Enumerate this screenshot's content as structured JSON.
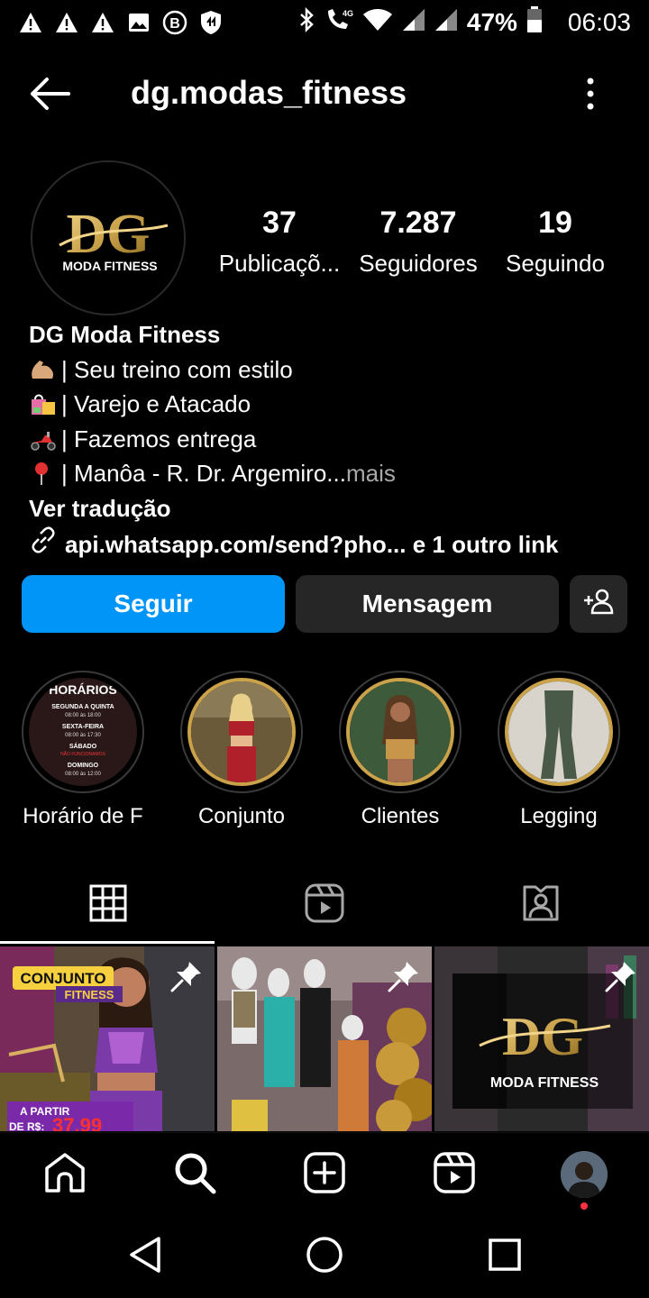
{
  "status_bar": {
    "battery": "47%",
    "time": "06:03",
    "icons_left": [
      "warning-icon",
      "warning-icon",
      "warning-icon",
      "image-icon",
      "b-icon",
      "shield-icon"
    ],
    "icons_right": [
      "bluetooth-icon",
      "phone-4g-icon",
      "wifi-icon",
      "signal-icon",
      "signal-icon",
      "battery-icon"
    ]
  },
  "header": {
    "username": "dg.modas_fitness"
  },
  "profile": {
    "avatar_text_top": "DG",
    "avatar_text_bottom": "MODA FITNESS",
    "stats": [
      {
        "value": "37",
        "label": "Publicaçõ..."
      },
      {
        "value": "7.287",
        "label": "Seguidores"
      },
      {
        "value": "19",
        "label": "Seguindo"
      }
    ],
    "name": "DG Moda Fitness",
    "bio_lines": [
      "| Seu treino com estilo",
      "| Varejo e Atacado",
      "| Fazemos entrega",
      "| Manôa - R. Dr. Argemiro..."
    ],
    "more_label": " mais",
    "translate_label": "Ver tradução",
    "link_text": "api.whatsapp.com/send?pho... e 1 outro link"
  },
  "buttons": {
    "follow": "Seguir",
    "message": "Mensagem"
  },
  "highlights": [
    {
      "label": "Horário de F",
      "title": "HORÁRIOS",
      "lines": [
        "SEGUNDA A QUINTA",
        "08:00 às 18:00",
        "SEXTA-FEIRA",
        "08:00 às 17:30",
        "SÁBADO",
        "NÃO FUNCIONAMOS",
        "DOMINGO",
        "08:00 às 12:00"
      ]
    },
    {
      "label": "Conjunto"
    },
    {
      "label": "Clientes"
    },
    {
      "label": "Legging"
    }
  ],
  "posts": [
    {
      "overlay_title": "CONJUNTO",
      "overlay_sub": "FITNESS",
      "price_prefix": "A PARTIR",
      "price_label": "DE R$:",
      "price": "37,99"
    },
    {},
    {
      "logo_top": "DG",
      "logo_bottom": "MODA FITNESS"
    }
  ],
  "colors": {
    "accent": "#0095f6",
    "button_dark": "#262626",
    "gold": "#c9a24a",
    "notification": "#ff3040"
  }
}
